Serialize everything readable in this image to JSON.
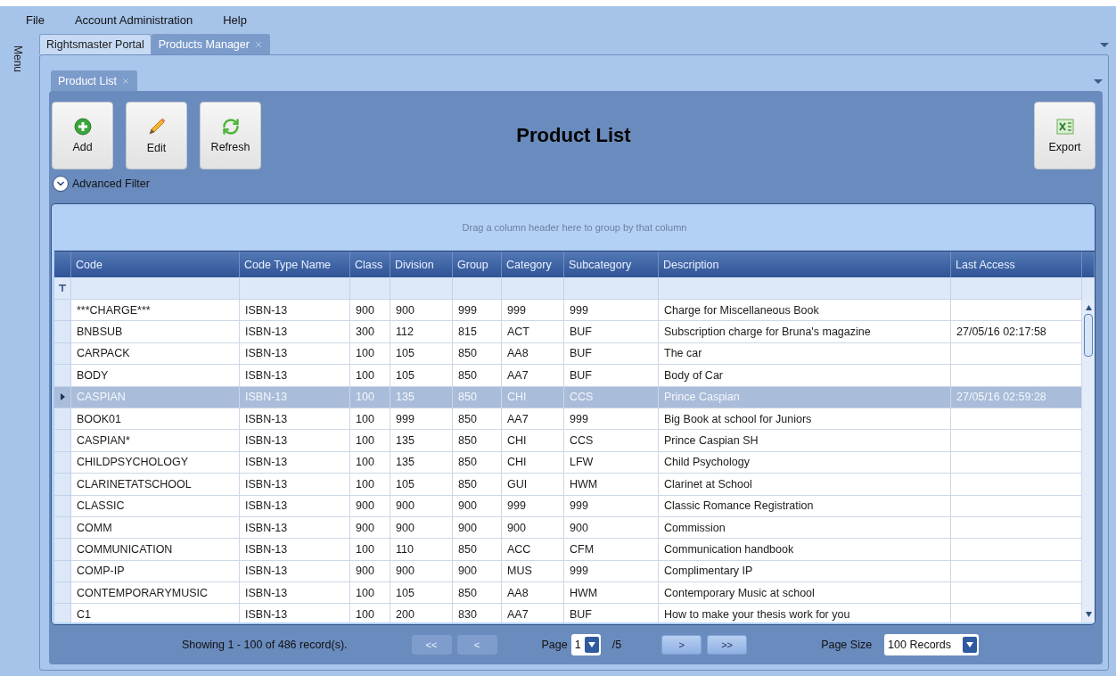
{
  "menu_bar": [
    {
      "label": "File"
    },
    {
      "label": "Account Administration"
    },
    {
      "label": "Help"
    }
  ],
  "side_menu": {
    "label": "Menu"
  },
  "outer_tabs": [
    {
      "label": "Rightsmaster Portal",
      "selected": false,
      "closable": false
    },
    {
      "label": "Products Manager",
      "selected": true,
      "closable": true
    }
  ],
  "inner_tabs": [
    {
      "label": "Product List",
      "selected": true,
      "closable": true
    }
  ],
  "toolbar": {
    "buttons": [
      {
        "label": "Add"
      },
      {
        "label": "Edit"
      },
      {
        "label": "Refresh"
      }
    ],
    "title": "Product List",
    "export": {
      "label": "Export"
    }
  },
  "advanced_filter": {
    "label": "Advanced Filter",
    "expanded": false
  },
  "table": {
    "group_hint": "Drag a column header here to group by that column",
    "columns": [
      "Code",
      "Code Type Name",
      "Class",
      "Division",
      "Group",
      "Category",
      "Subcategory",
      "Description",
      "Last Access"
    ],
    "rows": [
      {
        "selected": false,
        "cells": [
          "***CHARGE***",
          "ISBN-13",
          "900",
          "900",
          "999",
          "999",
          "999",
          "Charge for Miscellaneous Book",
          ""
        ]
      },
      {
        "selected": false,
        "cells": [
          "BNBSUB",
          "ISBN-13",
          "300",
          "112",
          "815",
          "ACT",
          "BUF",
          "Subscription charge for Bruna's magazine",
          "27/05/16 02:17:58"
        ]
      },
      {
        "selected": false,
        "cells": [
          "CARPACK",
          "ISBN-13",
          "100",
          "105",
          "850",
          "AA8",
          "BUF",
          "The car",
          ""
        ]
      },
      {
        "selected": false,
        "cells": [
          "BODY",
          "ISBN-13",
          "100",
          "105",
          "850",
          "AA7",
          "BUF",
          "Body of Car",
          ""
        ]
      },
      {
        "selected": true,
        "cells": [
          "CASPIAN",
          "ISBN-13",
          "100",
          "135",
          "850",
          "CHI",
          "CCS",
          "Prince Caspian",
          "27/05/16 02:59:28"
        ]
      },
      {
        "selected": false,
        "cells": [
          "BOOK01",
          "ISBN-13",
          "100",
          "999",
          "850",
          "AA7",
          "999",
          "Big Book at school for Juniors",
          ""
        ]
      },
      {
        "selected": false,
        "cells": [
          "CASPIAN*",
          "ISBN-13",
          "100",
          "135",
          "850",
          "CHI",
          "CCS",
          "Prince Caspian SH",
          ""
        ]
      },
      {
        "selected": false,
        "cells": [
          "CHILDPSYCHOLOGY",
          "ISBN-13",
          "100",
          "135",
          "850",
          "CHI",
          "LFW",
          "Child Psychology",
          ""
        ]
      },
      {
        "selected": false,
        "cells": [
          "CLARINETATSCHOOL",
          "ISBN-13",
          "100",
          "105",
          "850",
          "GUI",
          "HWM",
          "Clarinet at School",
          ""
        ]
      },
      {
        "selected": false,
        "cells": [
          "CLASSIC",
          "ISBN-13",
          "900",
          "900",
          "900",
          "999",
          "999",
          "Classic Romance Registration",
          ""
        ]
      },
      {
        "selected": false,
        "cells": [
          "COMM",
          "ISBN-13",
          "900",
          "900",
          "900",
          "900",
          "900",
          "Commission",
          ""
        ]
      },
      {
        "selected": false,
        "cells": [
          "COMMUNICATION",
          "ISBN-13",
          "100",
          "110",
          "850",
          "ACC",
          "CFM",
          "Communication handbook",
          ""
        ]
      },
      {
        "selected": false,
        "cells": [
          "COMP-IP",
          "ISBN-13",
          "900",
          "900",
          "900",
          "MUS",
          "999",
          "Complimentary IP",
          ""
        ]
      },
      {
        "selected": false,
        "cells": [
          "CONTEMPORARYMUSIC",
          "ISBN-13",
          "100",
          "105",
          "850",
          "AA8",
          "HWM",
          "Contemporary Music at school",
          ""
        ]
      },
      {
        "selected": false,
        "cells": [
          "C1",
          "ISBN-13",
          "100",
          "200",
          "830",
          "AA7",
          "BUF",
          "How to make your thesis work for you",
          ""
        ]
      }
    ]
  },
  "pager": {
    "summary": "Showing 1 - 100 of 486 record(s).",
    "buttons_before": [
      {
        "label": "<<",
        "disabled": true
      },
      {
        "label": "<",
        "disabled": true
      }
    ],
    "page_label": "Page",
    "page": "1",
    "page_total": "/5",
    "buttons_after": [
      {
        "label": ">",
        "disabled": false
      },
      {
        "label": ">>",
        "disabled": false
      }
    ],
    "page_size_label": "Page Size",
    "page_size": "100 Records"
  }
}
